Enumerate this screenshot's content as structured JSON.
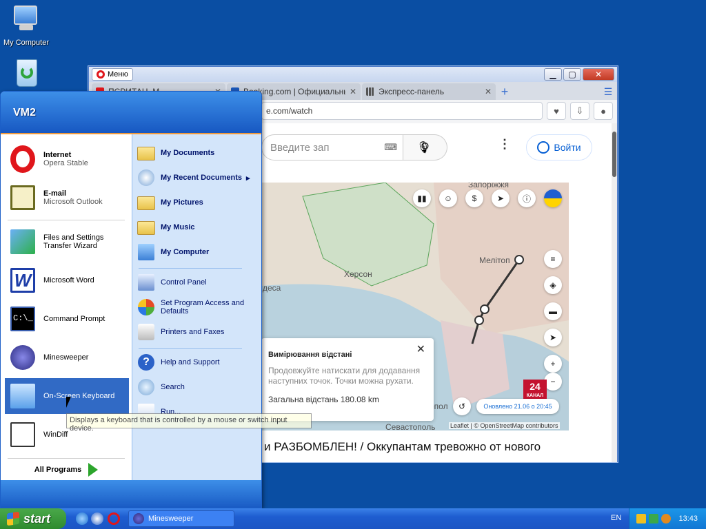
{
  "desktop": {
    "icons": [
      {
        "label": "My Computer"
      },
      {
        "label": ""
      }
    ]
  },
  "browser": {
    "menu_label": "Меню",
    "tabs": [
      {
        "title": "ПСРИТАН. М...",
        "active": false
      },
      {
        "title": "Booking.com | Официальны...",
        "active": false
      },
      {
        "title": "Экспресс-панель",
        "active": false
      }
    ],
    "url_visible": "e.com/watch",
    "youtube": {
      "search_placeholder": "Введите зап",
      "login_label": "Войти"
    },
    "map": {
      "labels": {
        "top": "Запоріжжя",
        "melitopol": "Мелітоп",
        "kherson": "Херсон",
        "desa": "деса",
        "sevastopol": "Севастополь",
        "simferopol": "опол"
      },
      "popup_title": "Вимірювання відстані",
      "popup_text": "Продовжуйте натискати для додавання наступних точок. Точки можна рухати.",
      "popup_total": "Загальна відстань 180.08 km",
      "updated": "Оновлено 21.06 о 20:45",
      "attribution": "Leaflet | © OpenStreetMap contributors",
      "badge": "24",
      "badge_sub": "КАНАЛ"
    },
    "headline": "и РАЗБОМБЛЕН! / Оккупантам тревожно от нового"
  },
  "start_menu": {
    "user": "VM2",
    "pinned": [
      {
        "title": "Internet",
        "subtitle": "Opera Stable"
      },
      {
        "title": "E-mail",
        "subtitle": "Microsoft Outlook"
      }
    ],
    "recent": [
      {
        "label": "Files and Settings Transfer Wizard"
      },
      {
        "label": "Microsoft Word"
      },
      {
        "label": "Command Prompt"
      },
      {
        "label": "Minesweeper"
      },
      {
        "label": "On-Screen Keyboard"
      },
      {
        "label": "WinDiff"
      }
    ],
    "all_programs": "All Programs",
    "right": {
      "my_documents": "My Documents",
      "my_recent_documents": "My Recent Documents",
      "my_pictures": "My Pictures",
      "my_music": "My Music",
      "my_computer": "My Computer",
      "control_panel": "Control Panel",
      "set_program_access": "Set Program Access and Defaults",
      "printers": "Printers and Faxes",
      "help": "Help and Support",
      "search": "Search",
      "run": "Run..."
    },
    "tooltip": "Displays a keyboard that is controlled by a mouse or switch input device."
  },
  "taskbar": {
    "start_label": "start",
    "task": "Minesweeper",
    "lang": "EN",
    "clock": "13:43"
  }
}
